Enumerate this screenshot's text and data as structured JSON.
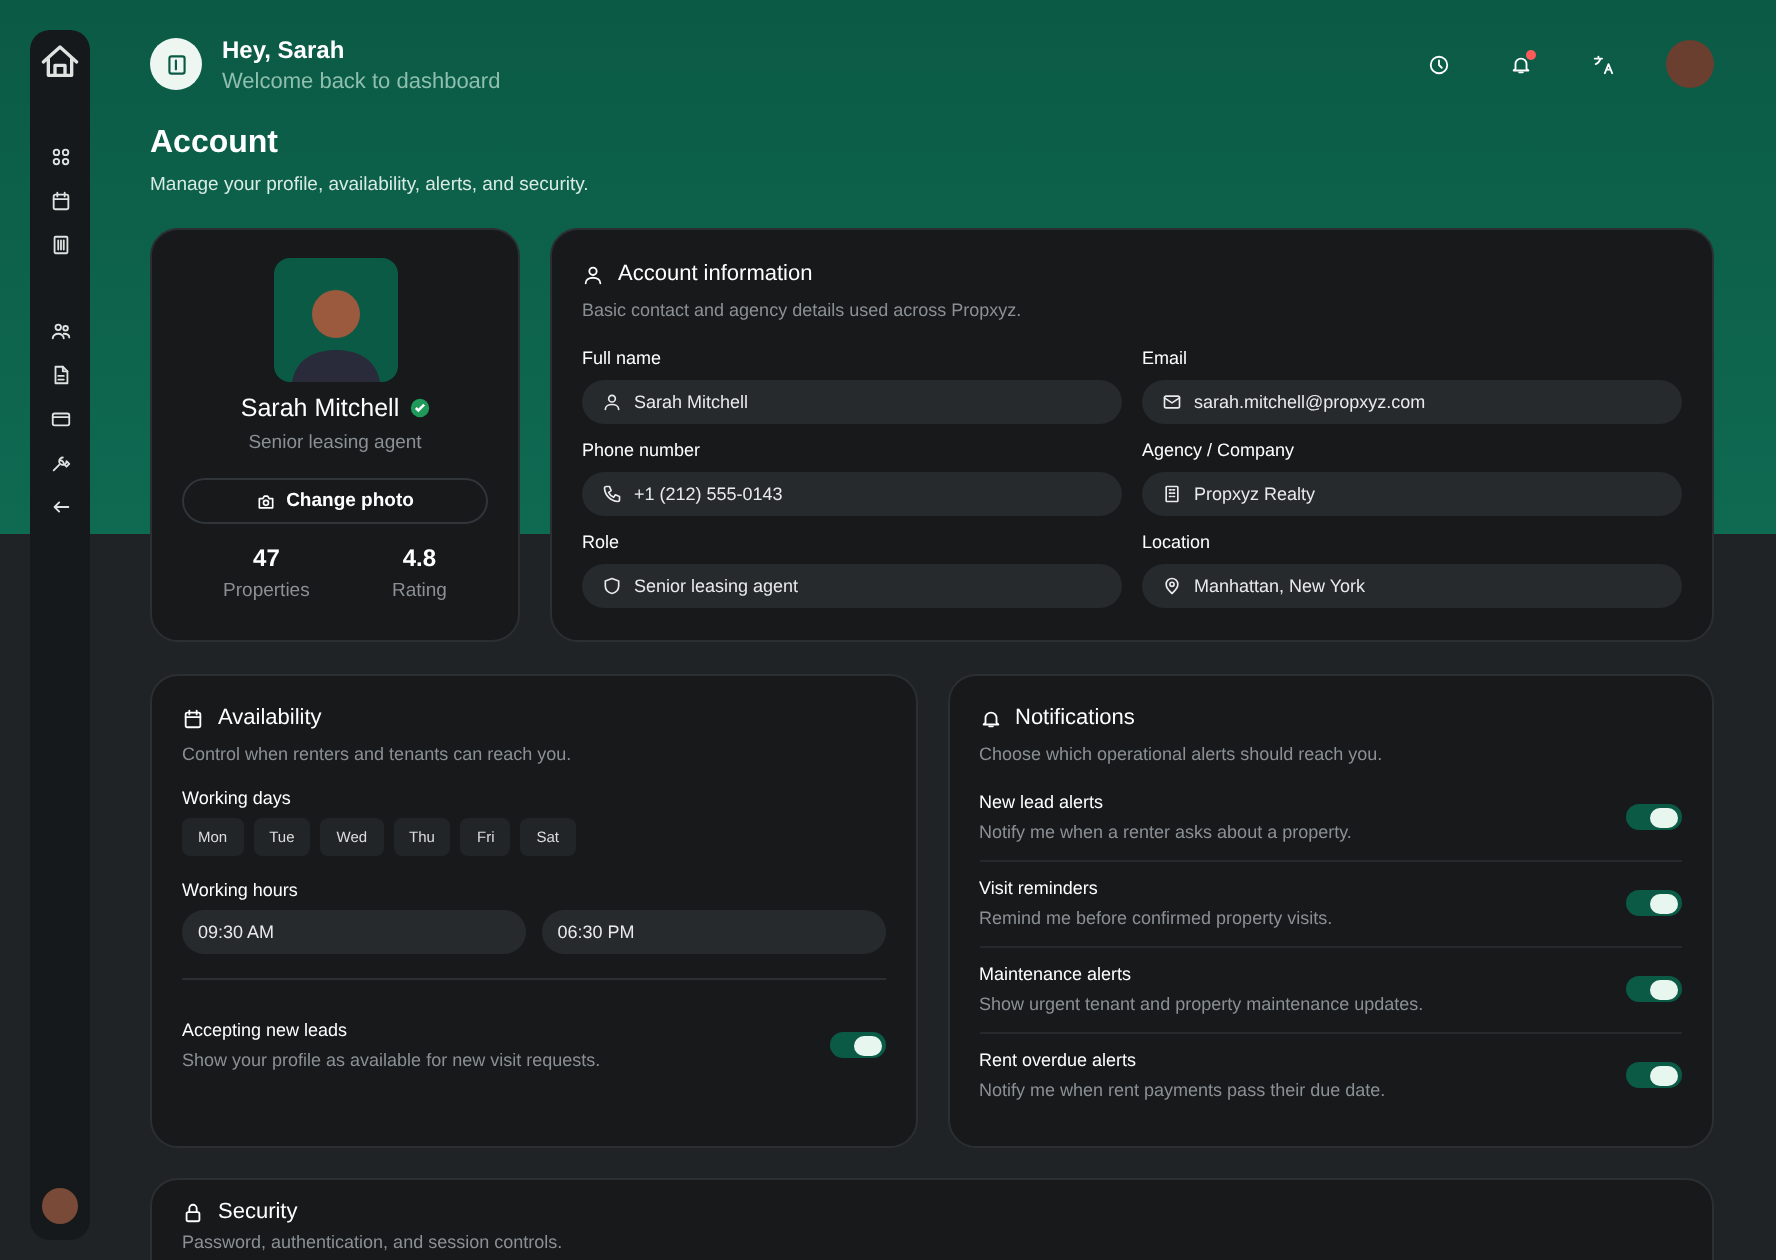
{
  "header": {
    "greeting": "Hey, Sarah",
    "subtitle": "Welcome back to dashboard",
    "notification_unread": true
  },
  "page": {
    "title": "Account",
    "subtitle": "Manage your profile, availability, alerts, and security."
  },
  "profile": {
    "name": "Sarah Mitchell",
    "verified": true,
    "role": "Senior leasing agent",
    "change_photo": "Change photo",
    "stats": [
      {
        "value": "47",
        "label": "Properties"
      },
      {
        "value": "4.8",
        "label": "Rating"
      }
    ]
  },
  "account_info": {
    "title": "Account information",
    "subtitle": "Basic contact and agency details used across Propxyz.",
    "fields": [
      {
        "label": "Full name",
        "value": "Sarah Mitchell",
        "kind": "person"
      },
      {
        "label": "Email",
        "value": "sarah.mitchell@propxyz.com",
        "kind": "mail"
      },
      {
        "label": "Phone number",
        "value": "+1 (212) 555-0143",
        "kind": "phone"
      },
      {
        "label": "Agency / Company",
        "value": "Propxyz Realty",
        "kind": "building"
      },
      {
        "label": "Role",
        "value": "Senior leasing agent",
        "kind": "shield"
      },
      {
        "label": "Location",
        "value": "Manhattan, New York",
        "kind": "pin"
      }
    ]
  },
  "availability": {
    "title": "Availability",
    "subtitle": "Control when renters and tenants can reach you.",
    "days_label": "Working days",
    "days": [
      "Mon",
      "Tue",
      "Wed",
      "Thu",
      "Fri",
      "Sat"
    ],
    "hours_label": "Working hours",
    "start": "09:30 AM",
    "end": "06:30 PM",
    "leads": {
      "label": "Accepting new leads",
      "description": "Show your profile as available for new visit requests.",
      "on": true
    }
  },
  "notifications": {
    "title": "Notifications",
    "subtitle": "Choose which operational alerts should reach you.",
    "items": [
      {
        "label": "New lead alerts",
        "description": "Notify me when a renter asks about a property.",
        "on": true
      },
      {
        "label": "Visit reminders",
        "description": "Remind me before confirmed property visits.",
        "on": true
      },
      {
        "label": "Maintenance alerts",
        "description": "Show urgent tenant and property maintenance updates.",
        "on": true
      },
      {
        "label": "Rent overdue alerts",
        "description": "Notify me when rent payments pass their due date.",
        "on": true
      }
    ]
  },
  "security": {
    "title": "Security",
    "subtitle": "Password, authentication, and session controls."
  }
}
